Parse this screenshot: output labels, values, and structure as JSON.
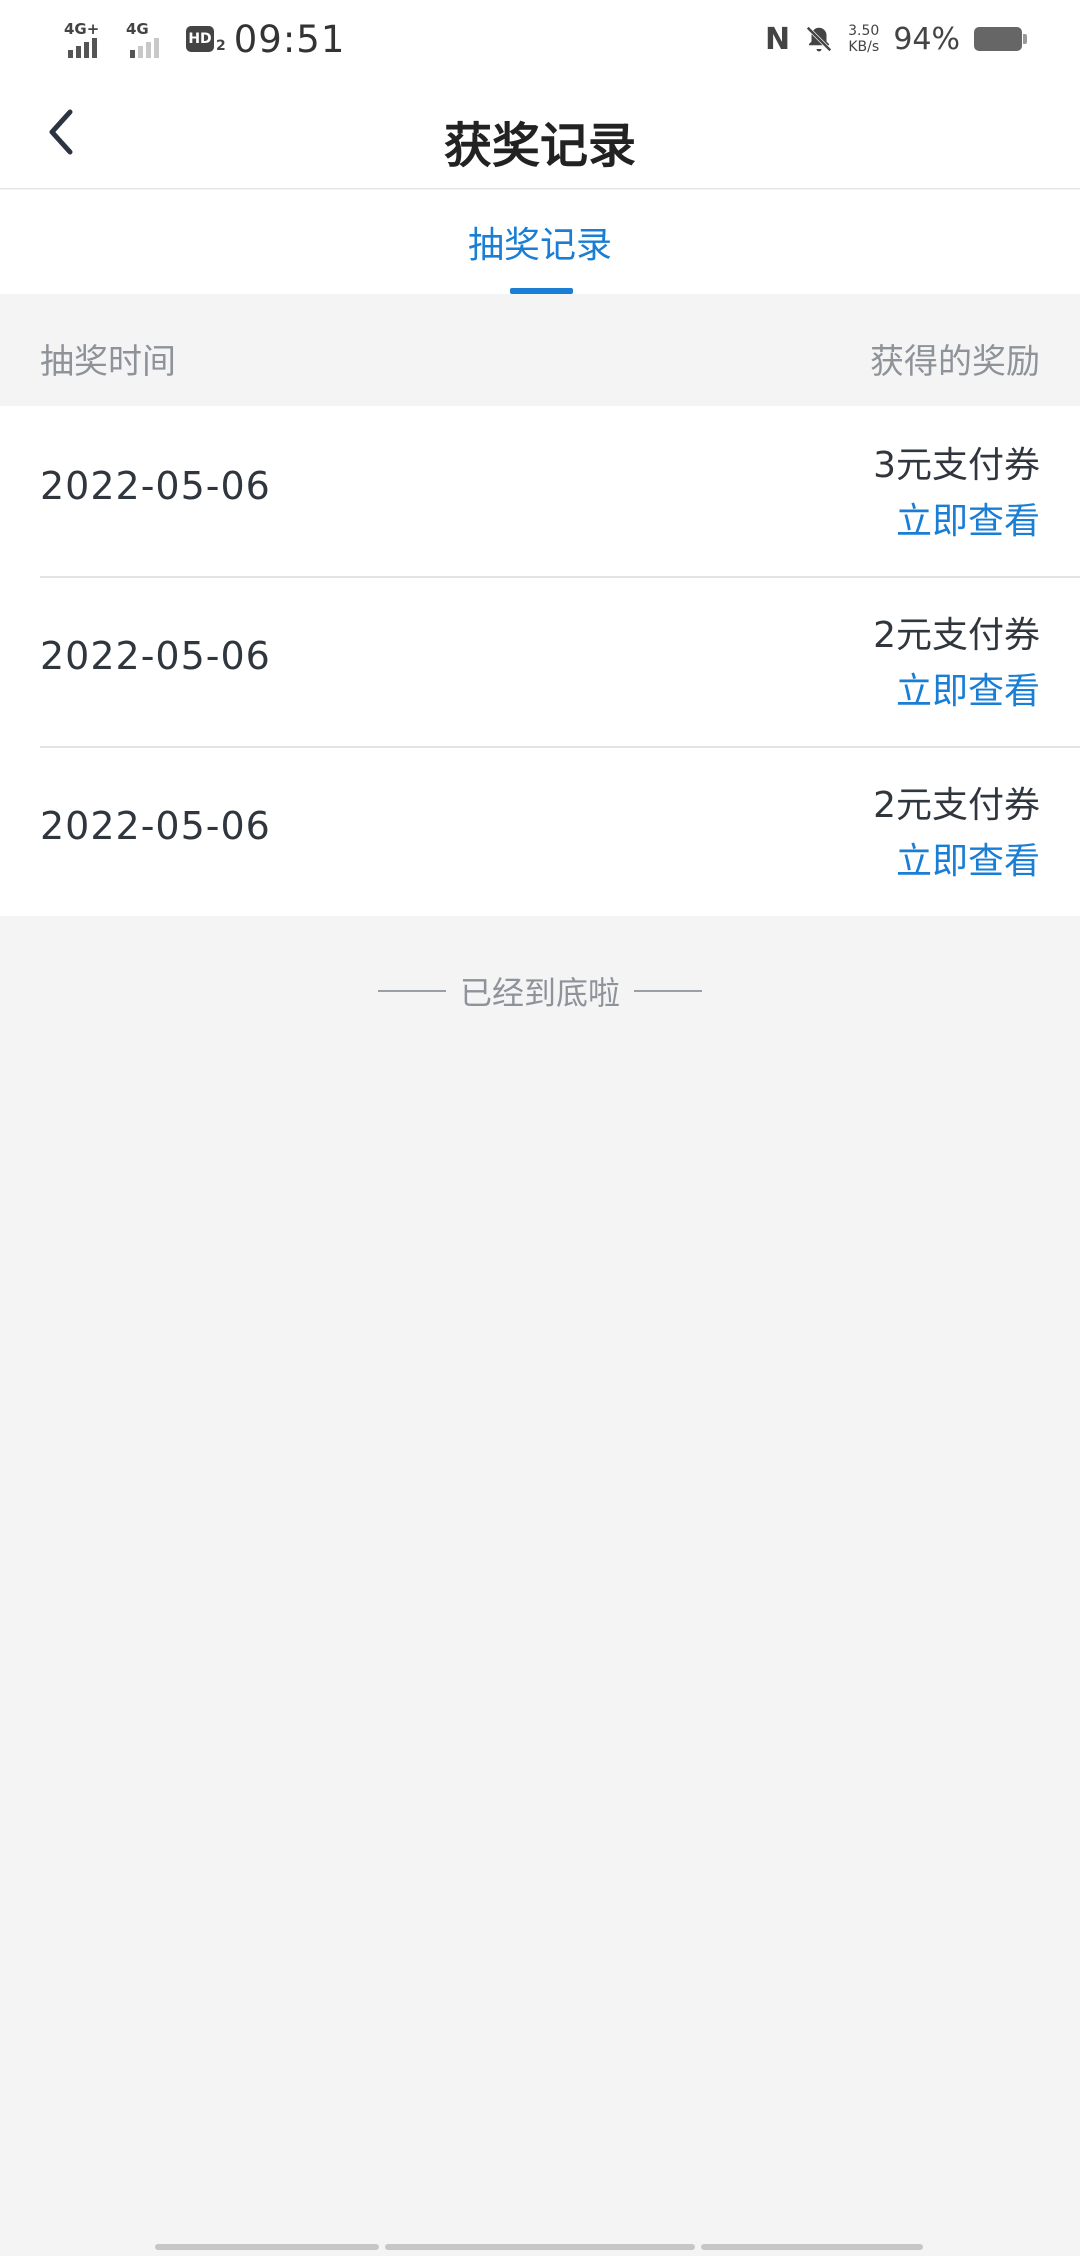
{
  "status_bar": {
    "sim1": "4G+",
    "sim2": "4G",
    "hd_label": "HD",
    "hd_sub": "2",
    "time": "09:51",
    "nfc": "N",
    "speed_value": "3.50",
    "speed_unit": "KB/s",
    "battery": "94%"
  },
  "header": {
    "title": "获奖记录"
  },
  "tabs": [
    {
      "label": "抽奖记录",
      "active": true
    }
  ],
  "table": {
    "col_time": "抽奖时间",
    "col_reward": "获得的奖励",
    "rows": [
      {
        "date": "2022-05-06",
        "reward": "3元支付券",
        "action": "立即查看"
      },
      {
        "date": "2022-05-06",
        "reward": "2元支付券",
        "action": "立即查看"
      },
      {
        "date": "2022-05-06",
        "reward": "2元支付券",
        "action": "立即查看"
      }
    ]
  },
  "footer_note": "已经到底啦",
  "colors": {
    "accent": "#1a7ed5",
    "background": "#f4f4f5"
  }
}
